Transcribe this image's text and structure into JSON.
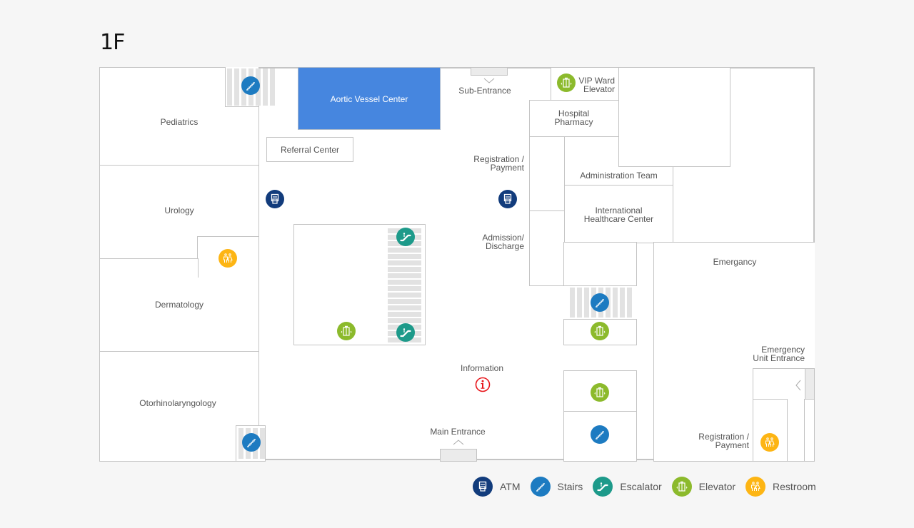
{
  "floor": "1F",
  "rooms": {
    "pediatrics": "Pediatrics",
    "urology": "Urology",
    "dermatology": "Dermatology",
    "otorhinolaryngology": "Otorhinolaryngology",
    "aortic_vessel_center": "Aortic Vessel Center",
    "referral_center": "Referral Center",
    "sub_entrance": "Sub-Entrance",
    "vip_ward_elevator": [
      "VIP Ward",
      "Elevator"
    ],
    "hospital_pharmacy": [
      "Hospital",
      "Pharmacy"
    ],
    "registration_payment": [
      "Registration /",
      "Payment"
    ],
    "administration_team": "Administration Team",
    "international_healthcare_center": [
      "International",
      "Healthcare Center"
    ],
    "admission_discharge": [
      "Admission/",
      "Discharge"
    ],
    "emergency": "Emergancy",
    "emergency_unit_entrance": [
      "Emergency",
      "Unit Entrance"
    ],
    "er_registration_payment": [
      "Registration /",
      "Payment"
    ],
    "information": "Information",
    "main_entrance": "Main Entrance"
  },
  "colors": {
    "atm": "#123c7c",
    "stairs": "#1d7bc1",
    "escalator": "#1d9a8a",
    "elevator": "#8cba2c",
    "restroom": "#fdb514",
    "highlight": "#4686df",
    "information": "#e8161b"
  },
  "legend": [
    {
      "icon": "atm-icon",
      "label": "ATM"
    },
    {
      "icon": "stairs-icon",
      "label": "Stairs"
    },
    {
      "icon": "escalator-icon",
      "label": "Escalator"
    },
    {
      "icon": "elevator-icon",
      "label": "Elevator"
    },
    {
      "icon": "restroom-icon",
      "label": "Restroom"
    }
  ]
}
